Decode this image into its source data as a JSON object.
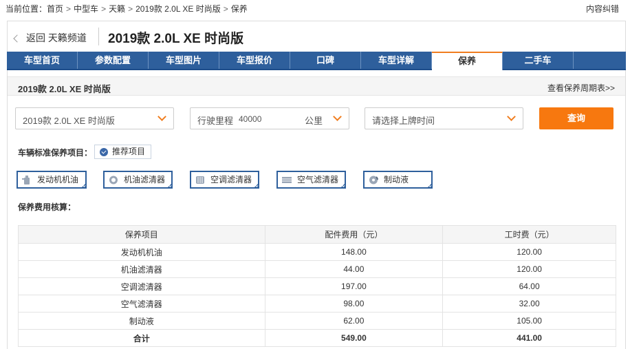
{
  "breadcrumb": {
    "prefix": "当前位置：",
    "items": [
      "首页",
      "中型车",
      "天籁",
      "2019款 2.0L XE 时尚版",
      "保养"
    ]
  },
  "report_label": "内容纠错",
  "header": {
    "back_label": "返回 天籁频道",
    "model_title": "2019款 2.0L XE 时尚版"
  },
  "nav": {
    "tabs": [
      "车型首页",
      "参数配置",
      "车型图片",
      "车型报价",
      "口碑",
      "车型详解",
      "保养",
      "二手车"
    ],
    "active": "保养"
  },
  "subheader": {
    "model_name": "2019款 2.0L XE 时尚版",
    "cycle_link": "查看保养周期表>>"
  },
  "filters": {
    "model_select": "2019款 2.0L XE 时尚版",
    "mileage_label": "行驶里程",
    "mileage_value": "40000",
    "mileage_unit": "公里",
    "date_placeholder": "请选择上牌时间",
    "query_label": "查询"
  },
  "standard_label": "车辆标准保养项目：",
  "recommended_label": "推荐项目",
  "items": [
    {
      "label": "发动机机油",
      "icon": "oil-bottle-icon"
    },
    {
      "label": "机油滤清器",
      "icon": "oil-filter-icon"
    },
    {
      "label": "空调滤清器",
      "icon": "ac-filter-icon"
    },
    {
      "label": "空气滤清器",
      "icon": "air-filter-icon"
    },
    {
      "label": "制动液",
      "icon": "brake-disc-icon"
    }
  ],
  "cost_label": "保养费用核算：",
  "table": {
    "headers": [
      "保养项目",
      "配件费用（元）",
      "工时费（元）"
    ],
    "rows": [
      [
        "发动机机油",
        "148.00",
        "120.00"
      ],
      [
        "机油滤清器",
        "44.00",
        "120.00"
      ],
      [
        "空调滤清器",
        "197.00",
        "64.00"
      ],
      [
        "空气滤清器",
        "98.00",
        "32.00"
      ],
      [
        "制动液",
        "62.00",
        "105.00"
      ]
    ],
    "total": [
      "合计",
      "549.00",
      "441.00"
    ]
  },
  "colors": {
    "nav_blue": "#2e5f9c",
    "accent_orange": "#f7780f"
  }
}
